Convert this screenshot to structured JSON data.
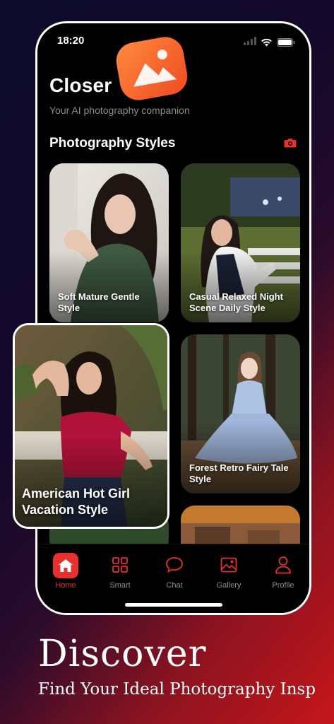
{
  "status_bar": {
    "time": "18:20"
  },
  "header": {
    "title": "Closer",
    "subtitle": "Your AI photography companion"
  },
  "section": {
    "title": "Photography Styles"
  },
  "cards": [
    {
      "label": "Soft Mature Gentle Style"
    },
    {
      "label": "Casual Relaxed Night Scene Daily Style"
    },
    {
      "label": "Forest Retro Fairy Tale Style"
    }
  ],
  "featured_card": {
    "label": "American Hot Girl Vacation Style"
  },
  "tabs": [
    {
      "label": "Home",
      "icon": "home-icon",
      "active": true
    },
    {
      "label": "Smart",
      "icon": "grid-icon",
      "active": false
    },
    {
      "label": "Chat",
      "icon": "chat-bubble-icon",
      "active": false
    },
    {
      "label": "Gallery",
      "icon": "image-icon",
      "active": false
    },
    {
      "label": "Profile",
      "icon": "person-icon",
      "active": false
    }
  ],
  "promo": {
    "title": "Discover",
    "subtitle": "Find Your Ideal Photography Insp"
  },
  "colors": {
    "accent": "#e5322c",
    "background": "#000000",
    "tab_inactive": "#8c8c8c"
  }
}
